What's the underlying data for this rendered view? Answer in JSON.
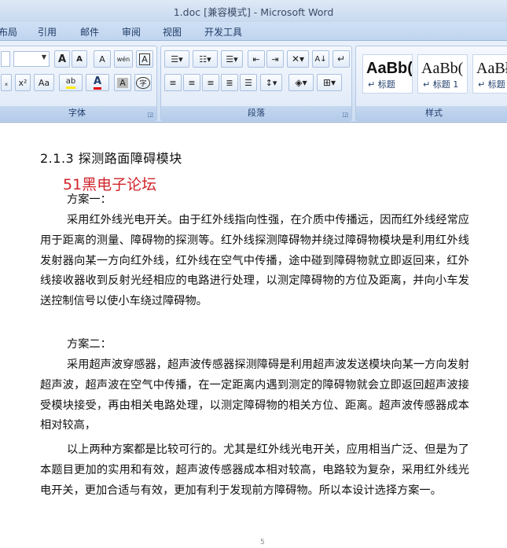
{
  "window": {
    "title": "1.doc [兼容模式] - Microsoft Word"
  },
  "ribbon": {
    "tabs": [
      "布局",
      "引用",
      "邮件",
      "审阅",
      "视图",
      "开发工具"
    ],
    "groups": {
      "font": "字体",
      "paragraph": "段落",
      "styles": "样式"
    },
    "styles": [
      {
        "preview": "AaBb(",
        "name": "↵ 标题"
      },
      {
        "preview": "AaBb(",
        "name": "↵ 标题 1"
      },
      {
        "preview": "AaBł",
        "name": "↵ 标题"
      }
    ],
    "font_buttons": {
      "superscript": "x²",
      "change_case": "Aa",
      "grow": "A",
      "shrink": "A",
      "clear": "A",
      "char_border": "A",
      "char_shading": "A",
      "phonetic": "wén"
    }
  },
  "document": {
    "heading": "2.1.3 探测路面障碍模块",
    "watermark": "51黑电子论坛",
    "p1": "方案一：",
    "p2": "采用红外线光电开关。由于红外线指向性强，在介质中传播远，因而红外线经常应用于距离的测量、障碍物的探测等。红外线探测障碍物并绕过障碍物模块是利用红外线发射器向某一方向红外线，红外线在空气中传播，途中碰到障碍物就立即返回来，红外线接收器收到反射光经相应的电路进行处理，以测定障碍物的方位及距离，并向小车发送控制信号以使小车绕过障碍物。",
    "p3": "方案二：",
    "p4": "采用超声波穿感器，超声波传感器探测障碍是利用超声波发送模块向某一方向发射超声波，超声波在空气中传播，在一定距离内遇到测定的障碍物就会立即返回超声波接受模块接受，再由相关电路处理，以测定障碍物的相关方位、距离。超声波传感器成本相对较高，",
    "p5": "以上两种方案都是比较可行的。尤其是红外线光电开关，应用相当广泛、但是为了本题目更加的实用和有效，超声波传感器成本相对较高，电路较为复杂，采用红外线光电开关，更加合适与有效，更加有利于发现前方障碍物。所以本设计选择方案一。",
    "page_number": "5"
  }
}
